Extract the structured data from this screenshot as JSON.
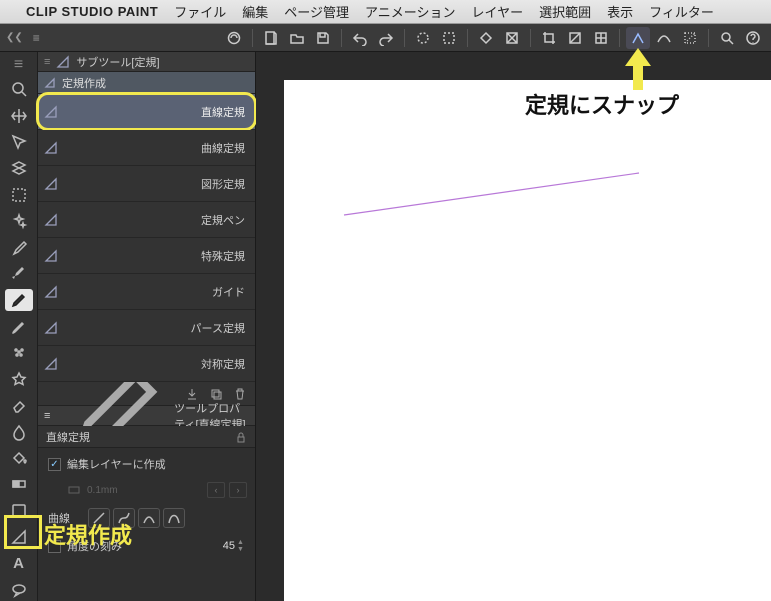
{
  "menubar": {
    "appname": "CLIP STUDIO PAINT",
    "items": [
      "ファイル",
      "編集",
      "ページ管理",
      "アニメーション",
      "レイヤー",
      "選択範囲",
      "表示",
      "フィルター"
    ]
  },
  "subtool_panel": {
    "title": "サブツール[定規]",
    "tab": "定規作成",
    "items": [
      {
        "label": "直線定規",
        "selected": true
      },
      {
        "label": "曲線定規",
        "selected": false
      },
      {
        "label": "図形定規",
        "selected": false
      },
      {
        "label": "定規ペン",
        "selected": false
      },
      {
        "label": "特殊定規",
        "selected": false
      },
      {
        "label": "ガイド",
        "selected": false
      },
      {
        "label": "パース定規",
        "selected": false
      },
      {
        "label": "対称定規",
        "selected": false
      }
    ]
  },
  "tool_property": {
    "title": "ツールプロパティ[直線定規]",
    "subtitle": "直線定規",
    "create_on_edit_layer": "編集レイヤーに作成",
    "curve": "曲線",
    "angle_step": "角度の刻み",
    "angle_value": "45",
    "unit_hint": "0.1mm"
  },
  "callouts": {
    "snap": "定規にスナップ",
    "ruler_create": "定規作成"
  }
}
